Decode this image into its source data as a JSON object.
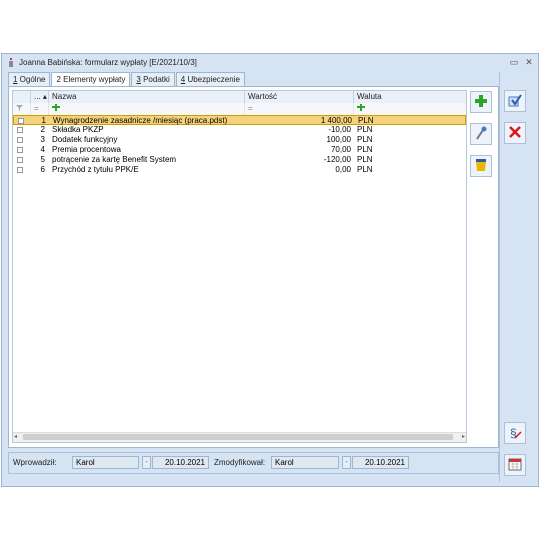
{
  "window": {
    "title": "Joanna Babińska: formularz wypłaty [E/2021/10/3]",
    "controls": {
      "minimize": "▭",
      "close": "✕"
    }
  },
  "tabs": [
    {
      "num": "1",
      "label": " Ogólne"
    },
    {
      "num": "2",
      "label": " Elementy wypłaty"
    },
    {
      "num": "3",
      "label": " Podatki"
    },
    {
      "num": "4",
      "label": " Ubezpieczenie"
    }
  ],
  "grid": {
    "headers": {
      "lp": "... ▴",
      "nazwa": "Nazwa",
      "wartosc": "Wartość",
      "waluta": "Waluta"
    },
    "filters": {
      "lp": "=",
      "wartosc": "="
    },
    "rows": [
      {
        "lp": "1",
        "nazwa": "Wynagrodzenie zasadnicze /miesiąc (praca.pdst)",
        "wartosc": "1 400,00",
        "waluta": "PLN"
      },
      {
        "lp": "2",
        "nazwa": "Składka PKZP",
        "wartosc": "-10,00",
        "waluta": "PLN"
      },
      {
        "lp": "3",
        "nazwa": "Dodatek funkcyjny",
        "wartosc": "100,00",
        "waluta": "PLN"
      },
      {
        "lp": "4",
        "nazwa": "Premia procentowa",
        "wartosc": "70,00",
        "waluta": "PLN"
      },
      {
        "lp": "5",
        "nazwa": "potrącenie za kartę Benefit System",
        "wartosc": "-120,00",
        "waluta": "PLN"
      },
      {
        "lp": "6",
        "nazwa": "Przychód z tytułu PPK/E",
        "wartosc": "0,00",
        "waluta": "PLN"
      }
    ],
    "selected_row": 0
  },
  "footer": {
    "entered_label": "Wprowadził:",
    "entered_by": "Karol",
    "entered_date": "20.10.2021",
    "modified_label": "Zmodyfikował:",
    "modified_by": "Karol",
    "modified_date": "20.10.2021",
    "date_btn": "-"
  },
  "icons": {
    "add": "plus-icon",
    "edit": "pipette-icon",
    "delete_all": "bucket-icon",
    "save": "save-check-icon",
    "cancel": "red-x-icon",
    "paragraph": "paragraph-icon",
    "calendar": "calendar-icon"
  },
  "colors": {
    "selected_row": "#f7d27c",
    "window_bg": "#d6e3f2",
    "accent_red": "#d81818",
    "accent_green": "#2aa52a"
  }
}
